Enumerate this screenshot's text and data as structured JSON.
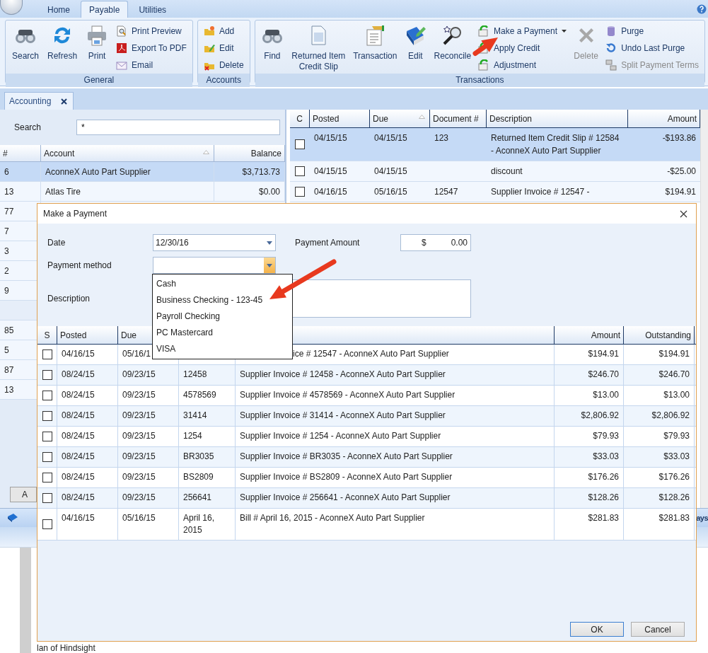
{
  "ribbon": {
    "tabs": [
      {
        "label": "Home",
        "selected": false
      },
      {
        "label": "Payable",
        "selected": true
      },
      {
        "label": "Utilities",
        "selected": false
      }
    ],
    "groups": [
      {
        "label": "General",
        "items": [
          {
            "label": "Search",
            "kind": "large",
            "disabled": false
          },
          {
            "label": "Refresh",
            "kind": "large",
            "disabled": false
          },
          {
            "label": "Print",
            "kind": "large",
            "disabled": false
          },
          {
            "label": "Print Preview",
            "kind": "small",
            "disabled": false
          },
          {
            "label": "Export To PDF",
            "kind": "small",
            "disabled": false
          },
          {
            "label": "Email",
            "kind": "small",
            "disabled": false
          }
        ]
      },
      {
        "label": "Accounts",
        "items": [
          {
            "label": "Add",
            "kind": "small",
            "disabled": false
          },
          {
            "label": "Edit",
            "kind": "small",
            "disabled": false
          },
          {
            "label": "Delete",
            "kind": "small",
            "disabled": false
          }
        ]
      },
      {
        "label": "Transactions",
        "items": [
          {
            "label": "Find",
            "kind": "large",
            "disabled": false
          },
          {
            "label": "Returned Item Credit Slip",
            "kind": "large",
            "disabled": false
          },
          {
            "label": "Transaction",
            "kind": "large",
            "disabled": false
          },
          {
            "label": "Edit",
            "kind": "large",
            "disabled": false
          },
          {
            "label": "Reconcile",
            "kind": "large",
            "disabled": false
          },
          {
            "label": "Make a Payment",
            "kind": "split",
            "disabled": false
          },
          {
            "label": "Apply Credit",
            "kind": "small",
            "disabled": false
          },
          {
            "label": "Adjustment",
            "kind": "small",
            "disabled": false
          },
          {
            "label": "Delete",
            "kind": "large",
            "disabled": true
          },
          {
            "label": "Purge",
            "kind": "small",
            "disabled": false
          },
          {
            "label": "Undo Last Purge",
            "kind": "small",
            "disabled": false
          },
          {
            "label": "Split Payment Terms",
            "kind": "small",
            "disabled": true
          }
        ]
      }
    ]
  },
  "document_tabs": [
    {
      "label": "Accounting",
      "selected": true
    }
  ],
  "accounts": {
    "search_label": "Search",
    "search_value": "*",
    "columns": [
      {
        "label": "#",
        "sorted": false
      },
      {
        "label": "Account",
        "sorted": true
      },
      {
        "label": "Balance",
        "sorted": false
      }
    ],
    "rows": [
      {
        "kind": "account",
        "number": "6",
        "name": "AconneX Auto Part Supplier",
        "balance": "$3,713.73",
        "selected": true
      },
      {
        "kind": "account",
        "number": "13",
        "name": "Atlas Tire",
        "balance": "$0.00",
        "selected": false
      },
      {
        "kind": "account",
        "number": "77",
        "selected": false
      },
      {
        "kind": "account",
        "number": "7",
        "selected": false
      },
      {
        "kind": "account",
        "number": "3",
        "selected": false
      },
      {
        "kind": "account",
        "number": "2",
        "selected": false
      },
      {
        "kind": "account",
        "number": "9",
        "selected": false
      },
      {
        "kind": "blank",
        "selected": false
      },
      {
        "kind": "account",
        "number": "85",
        "selected": false
      },
      {
        "kind": "account",
        "number": "5",
        "selected": false
      },
      {
        "kind": "account",
        "number": "87",
        "selected": false
      },
      {
        "kind": "account",
        "number": "13",
        "selected": false
      }
    ],
    "button": "A"
  },
  "transactions": {
    "columns": [
      {
        "label": "C",
        "sorted": false
      },
      {
        "label": "Posted",
        "sorted": false
      },
      {
        "label": "Due",
        "sorted": true
      },
      {
        "label": "Document #",
        "sorted": false
      },
      {
        "label": "Description",
        "sorted": false
      },
      {
        "label": "Amount",
        "sorted": false
      }
    ],
    "rows": [
      {
        "checked": false,
        "selected": true,
        "posted": "04/15/15",
        "due": "04/15/15",
        "document": "123",
        "description": "Returned Item Credit Slip # 12584 - AconneX Auto Part Supplier",
        "amount": "-$193.86"
      },
      {
        "checked": false,
        "selected": false,
        "posted": "04/15/15",
        "due": "04/15/15",
        "description": "discount",
        "amount": "-$25.00"
      },
      {
        "checked": false,
        "selected": false,
        "posted": "04/16/15",
        "due": "05/16/15",
        "document": "12547",
        "description": "Supplier Invoice # 12547 -",
        "amount": "$194.91"
      }
    ]
  },
  "footer_text": "ays",
  "background_text": "lan of Hindsight",
  "dialog": {
    "title": "Make a Payment",
    "date_label": "Date",
    "date_value": "12/30/16",
    "amount_label": "Payment Amount",
    "currency": "$",
    "amount_value": "0.00",
    "method_label": "Payment method",
    "description_label": "Description",
    "method_dropdown": {
      "open": true,
      "options": [
        {
          "label": "Cash",
          "selected": false
        },
        {
          "label": "Business Checking - 123-45",
          "selected": false
        },
        {
          "label": "Payroll Checking",
          "selected": false
        },
        {
          "label": "PC Mastercard",
          "selected": false
        },
        {
          "label": "VISA",
          "selected": false
        }
      ]
    },
    "columns": [
      "S",
      "Posted",
      "Due",
      "Amount",
      "Outstanding"
    ],
    "rows": [
      {
        "checked": false,
        "covered": true,
        "posted": "04/16/15",
        "due": "05/16/1",
        "description": "ice # 12547 - AconneX Auto Part Supplier",
        "amount": "$194.91",
        "outstanding": "$194.91"
      },
      {
        "checked": false,
        "covered": false,
        "posted": "08/24/15",
        "due": "09/23/15",
        "document": "12458",
        "description": "Supplier Invoice # 12458 - AconneX Auto Part Supplier",
        "amount": "$246.70",
        "outstanding": "$246.70"
      },
      {
        "checked": false,
        "covered": false,
        "posted": "08/24/15",
        "due": "09/23/15",
        "document": "4578569",
        "description": "Supplier Invoice # 4578569 - AconneX Auto Part Supplier",
        "amount": "$13.00",
        "outstanding": "$13.00"
      },
      {
        "checked": false,
        "covered": false,
        "posted": "08/24/15",
        "due": "09/23/15",
        "document": "31414",
        "description": "Supplier Invoice # 31414 - AconneX Auto Part Supplier",
        "amount": "$2,806.92",
        "outstanding": "$2,806.92"
      },
      {
        "checked": false,
        "covered": false,
        "posted": "08/24/15",
        "due": "09/23/15",
        "document": "1254",
        "description": "Supplier Invoice # 1254 - AconneX Auto Part Supplier",
        "amount": "$79.93",
        "outstanding": "$79.93"
      },
      {
        "checked": false,
        "covered": false,
        "posted": "08/24/15",
        "due": "09/23/15",
        "document": "BR3035",
        "description": "Supplier Invoice # BR3035 - AconneX Auto Part Supplier",
        "amount": "$33.03",
        "outstanding": "$33.03"
      },
      {
        "checked": false,
        "covered": false,
        "posted": "08/24/15",
        "due": "09/23/15",
        "document": "BS2809",
        "description": "Supplier Invoice # BS2809 - AconneX Auto Part Supplier",
        "amount": "$176.26",
        "outstanding": "$176.26"
      },
      {
        "checked": false,
        "covered": false,
        "posted": "08/24/15",
        "due": "09/23/15",
        "document": "256641",
        "description": "Supplier Invoice # 256641 - AconneX Auto Part Supplier",
        "amount": "$128.26",
        "outstanding": "$128.26"
      },
      {
        "checked": false,
        "covered": false,
        "posted": "04/16/15",
        "due": "05/16/15",
        "document": "April 16, 2015",
        "description": "Bill # April 16, 2015 - AconneX Auto Part Supplier",
        "amount": "$281.83",
        "outstanding": "$281.83"
      }
    ],
    "buttons": [
      {
        "label": "OK",
        "default": true
      },
      {
        "label": "Cancel",
        "default": false
      }
    ]
  }
}
